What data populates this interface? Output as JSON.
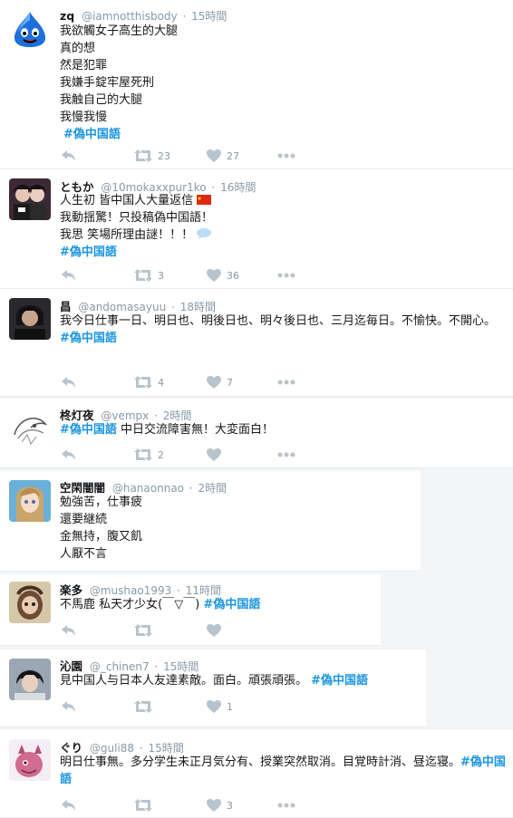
{
  "tweets": [
    {
      "name": "zq",
      "handle": "@iamnotthisbody",
      "time": "15時間",
      "lines": [
        "我欲觸女子高生的大腿",
        "真的想",
        "然是犯罪",
        "我嫌手錠牢屋死刑",
        "我触自己的大腿",
        "我慢我慢"
      ],
      "hashtag": "#偽中国語",
      "retweets": "23",
      "likes": "27"
    },
    {
      "name": "ともか",
      "handle": "@10mokaxxpur1ko",
      "time": "16時間",
      "lines": [
        "人生初 皆中国人大量返信",
        "我動揺驚！只投稿偽中国語！",
        "我思 笑場所理由謎！！！"
      ],
      "hashtag": "#偽中国語",
      "retweets": "3",
      "likes": "36"
    },
    {
      "name": "昌",
      "handle": "@andomasayuu",
      "time": "18時間",
      "text": "我今日仕事一日、明日也、明後日也、明々後日也、三月迄毎日。不愉快。不開心。",
      "hashtag": "#偽中国語",
      "retweets": "4",
      "likes": "7"
    },
    {
      "name": "柊灯夜",
      "handle": "@vempx",
      "time": "2時間",
      "hashtag": "#偽中国語",
      "text_after": "中日交流障害無！大変面白！",
      "retweets": "2",
      "likes": ""
    },
    {
      "name": "空閑闇闇",
      "handle": "@hanaonnao",
      "time": "2時間",
      "lines": [
        "勉強苦，仕事疲",
        "還要継続",
        "金無持，腹又飢",
        "人厭不言"
      ]
    },
    {
      "name": "楽多",
      "handle": "@mushao1993",
      "time": "11時間",
      "text": "不馬鹿 私天才少女(￣▽￣)",
      "hashtag": "#偽中国語"
    },
    {
      "name": "沁園",
      "handle": "@_chinen7",
      "time": "15時間",
      "text": "見中国人与日本人友達素敵。面白。頑張頑張。",
      "hashtag": "#偽中国語",
      "likes": "1"
    },
    {
      "name": "ぐり",
      "handle": "@guli88",
      "time": "15時間",
      "text": "明日仕事無。多分学生未正月気分有、授業突然取消。目覚時計消、昼迄寝。",
      "hashtag": "#偽中国語",
      "likes": "3"
    }
  ],
  "sep": "·",
  "colors": {
    "link": "#1b95e0",
    "meta": "#8899a6",
    "icon": "#b8c4cd"
  }
}
